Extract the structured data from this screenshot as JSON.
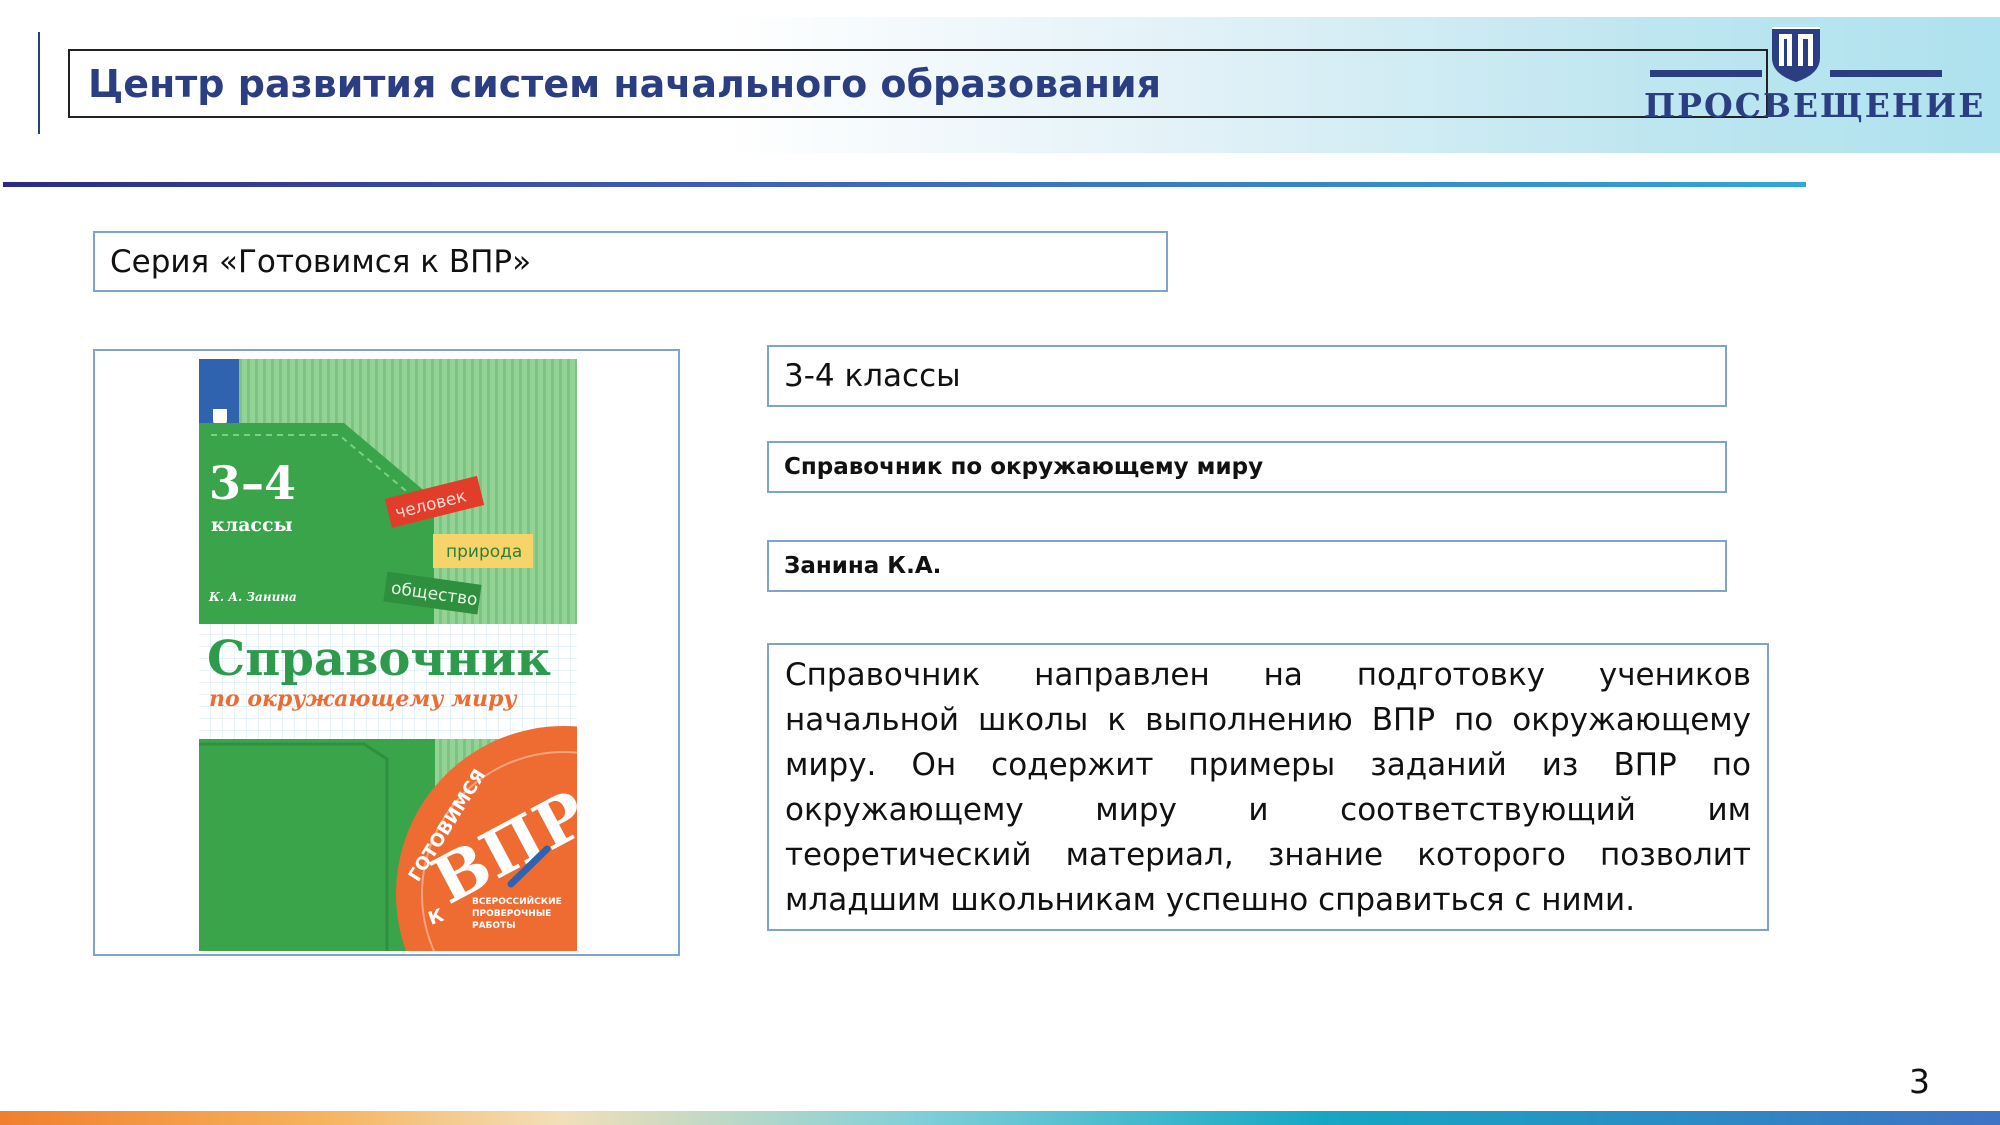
{
  "header": {
    "title": "Центр развития систем начального образования",
    "logo_text": "ПРОСВЕЩЕНИЕ",
    "logo_icon": "prosveshchenie-shield-icon"
  },
  "series": {
    "label": "Серия «Готовимся к ВПР»"
  },
  "book": {
    "grade": "3-4 классы",
    "title": "Справочник по окружающему миру",
    "author": "Занина К.А.",
    "description": "Справочник направлен на подготовку учеников начальной школы к выполнению ВПР по окружающему миру. Он содержит примеры заданий из ВПР по окружающему миру и соответствующий им теоретический материал, знание которого позволит младшим школьникам успешно справиться с ними."
  },
  "cover": {
    "grade_number": "3–4",
    "grade_word": "классы",
    "author": "К. А. Занина",
    "tag_1": "человек",
    "tag_2": "природа",
    "tag_3": "общество",
    "title": "Справочник",
    "subtitle": "по окружающему миру",
    "badge_arc": "ГОТОВИМСЯ",
    "badge_k": "К",
    "badge_main": "ВПР",
    "badge_small_1": "ВСЕРОССИЙСКИЕ",
    "badge_small_2": "ПРОВЕРОЧНЫЕ",
    "badge_small_3": "РАБОТЫ",
    "colors": {
      "green_light": "#8ccf8f",
      "green_dark": "#3aa44b",
      "orange": "#ee6b32",
      "accent_red": "#e23d2a"
    }
  },
  "page_number": "3",
  "colors": {
    "brand_blue": "#2c3e82",
    "box_border": "#7ea3cc"
  }
}
